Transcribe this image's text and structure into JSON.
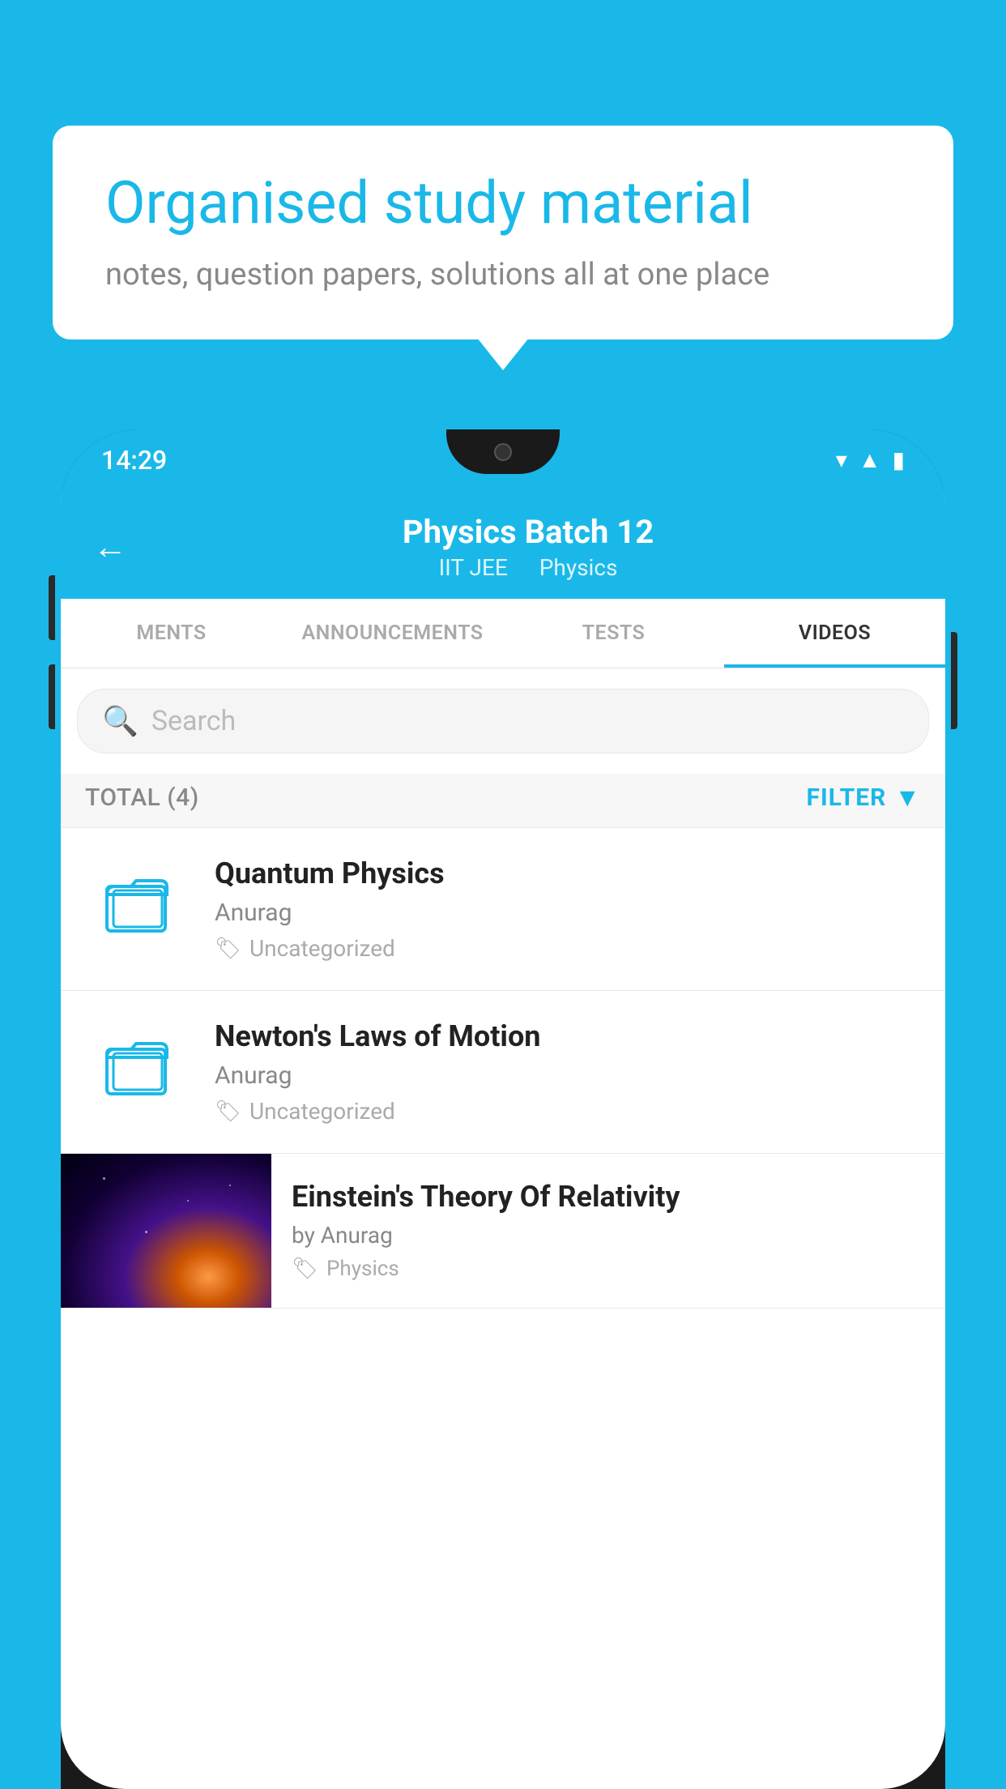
{
  "app": {
    "background_color": "#1ab8e8"
  },
  "bubble": {
    "title": "Organised study material",
    "subtitle": "notes, question papers, solutions all at one place"
  },
  "phone": {
    "status_bar": {
      "time": "14:29"
    },
    "header": {
      "back_label": "←",
      "title": "Physics Batch 12",
      "subtitle_part1": "IIT JEE",
      "subtitle_part2": "Physics"
    },
    "tabs": [
      {
        "label": "MENTS",
        "active": false
      },
      {
        "label": "ANNOUNCEMENTS",
        "active": false
      },
      {
        "label": "TESTS",
        "active": false
      },
      {
        "label": "VIDEOS",
        "active": true
      }
    ],
    "search": {
      "placeholder": "Search"
    },
    "filter": {
      "total_label": "TOTAL (4)",
      "button_label": "FILTER"
    },
    "videos": [
      {
        "id": 1,
        "title": "Quantum Physics",
        "author": "Anurag",
        "tag": "Uncategorized",
        "type": "folder"
      },
      {
        "id": 2,
        "title": "Newton's Laws of Motion",
        "author": "Anurag",
        "tag": "Uncategorized",
        "type": "folder"
      },
      {
        "id": 3,
        "title": "Einstein's Theory Of Relativity",
        "author": "by Anurag",
        "tag": "Physics",
        "type": "video"
      }
    ]
  }
}
